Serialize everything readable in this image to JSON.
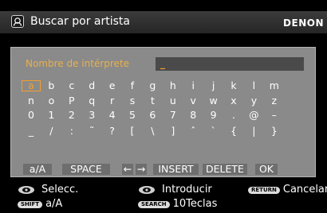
{
  "header": {
    "title": "Buscar por artista",
    "brand": "DENON"
  },
  "keyboard": {
    "field_label": "Nombre de intérprete",
    "field_value": "_",
    "rows": [
      [
        "a",
        "b",
        "c",
        "d",
        "e",
        "f",
        "g",
        "h",
        "i",
        "j",
        "k",
        "l",
        "m"
      ],
      [
        "n",
        "o",
        "P",
        "q",
        "r",
        "s",
        "t",
        "u",
        "v",
        "w",
        "x",
        "y",
        "z"
      ],
      [
        "0",
        "1",
        "2",
        "3",
        "4",
        "5",
        "6",
        "7",
        "8",
        "9",
        ".",
        "@",
        "–"
      ],
      [
        "_",
        "/",
        ":",
        "˜",
        "?",
        "[",
        "\\",
        "]",
        "ˆ",
        "`",
        "{",
        "|",
        "}"
      ]
    ],
    "selected_key": "a",
    "functions": {
      "case": "a/A",
      "space": "SPACE",
      "left": "←",
      "right": "→",
      "insert": "INSERT",
      "delete": "DELETE",
      "ok": "OK"
    }
  },
  "footer": {
    "select_label": "Selecc.",
    "enter_label": "Introducir",
    "return_button": "RETURN",
    "cancel_label": "Cancelar",
    "shift_button": "SHIFT",
    "shift_label": "a/A",
    "search_button": "SEARCH",
    "search_label": "10Teclas"
  },
  "colors": {
    "accent": "#f0a030",
    "panel": "#8a8a8a",
    "background": "#000000"
  }
}
